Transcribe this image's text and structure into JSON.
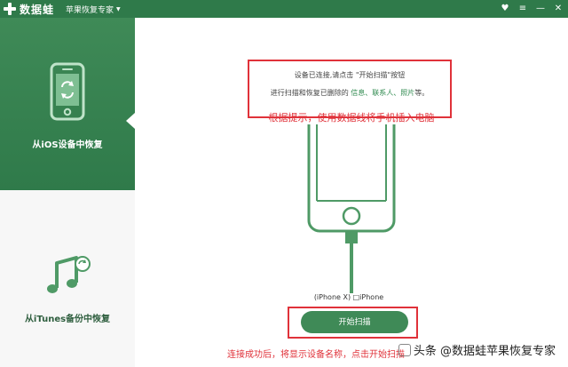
{
  "titlebar": {
    "app_name": "数据蛙",
    "subtitle": "苹果恢复专家",
    "controls": [
      "♥",
      "≡",
      "—",
      "✕"
    ]
  },
  "sidebar": {
    "items": [
      {
        "label": "从iOS设备中恢复",
        "active": true,
        "icon": "iphone-refresh-icon"
      },
      {
        "label": "从iTunes备份中恢复",
        "active": false,
        "icon": "music-note-icon"
      }
    ]
  },
  "main": {
    "info_line1": "设备已连接,请点击 \"开始扫描\"按钮",
    "info_line2_pre": "进行扫描和恢复已删除的 ",
    "info_line2_highlight": "信息、联系人、照片",
    "info_line2_post": "等。",
    "hint_top": "根据提示，使用数据线将手机插入电脑",
    "phone_caption": "(iPhone X) □iPhone",
    "scan_button": "开始扫描",
    "hint_bottom": "连接成功后，将显示设备名称，点击开始扫描"
  },
  "watermark": "头条 @数据蛙苹果恢复专家",
  "colors": {
    "brand_green": "#2f7a4a",
    "button_green": "#3f8a57",
    "annotation_red": "#e0323a"
  }
}
